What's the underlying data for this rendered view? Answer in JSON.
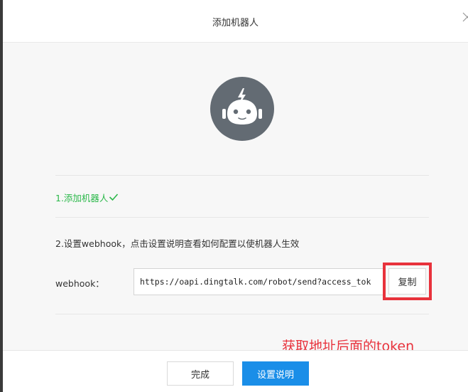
{
  "dialog": {
    "title": "添加机器人",
    "close_icon": "close-icon"
  },
  "robot_avatar": {
    "icon": "robot-icon",
    "background_color": "#636b73"
  },
  "step1": {
    "label": "1.添加机器人",
    "status_icon": "check-icon",
    "color": "#2bb84a"
  },
  "step2": {
    "instruction": "2.设置webhook，点击设置说明查看如何配置以使机器人生效"
  },
  "webhook": {
    "label": "webhook：",
    "value": "https://oapi.dingtalk.com/robot/send?access_tok",
    "copy_label": "复制"
  },
  "annotation": {
    "text": "获取地址后面的token",
    "color": "#e8323c"
  },
  "footer": {
    "done_label": "完成",
    "help_label": "设置说明",
    "primary_color": "#1a8ee8"
  }
}
